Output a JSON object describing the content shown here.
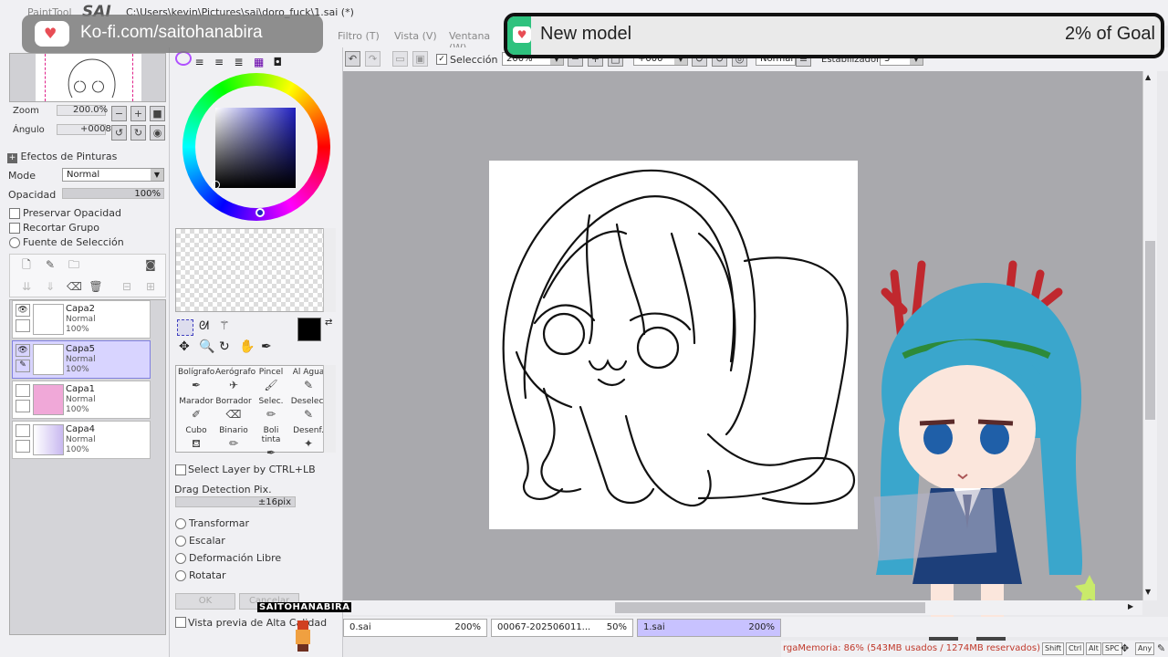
{
  "titlebar": {
    "app": "PaintTool",
    "logo": "SAI",
    "path": "C:\\Users\\kevin\\Pictures\\sai\\doro_fuck\\1.sai (*)"
  },
  "menu": {
    "filtro": "Filtro (T)",
    "vista": "Vista (V)",
    "ventana": "Ventana (W)"
  },
  "kofi": {
    "text": "Ko-fi.com/saitohanabira"
  },
  "goal": {
    "name": "New model",
    "progress": "2% of Goal",
    "accent": "#2ec27e"
  },
  "navigator": {
    "zoom_label": "Zoom",
    "zoom_value": "200.0%",
    "angle_label": "Ángulo",
    "angle_value": "+0008"
  },
  "effects": {
    "title": "Efectos de Pinturas",
    "mode_label": "Mode",
    "mode_value": "Normal",
    "opacity_label": "Opacidad",
    "opacity_value": "100%",
    "preserve": "Preservar Opacidad",
    "clip": "Recortar Grupo",
    "selection_source": "Fuente de Selección"
  },
  "layers": [
    {
      "name": "Capa2",
      "mode": "Normal",
      "opacity": "100%",
      "visible": true,
      "selected": false
    },
    {
      "name": "Capa5",
      "mode": "Normal",
      "opacity": "100%",
      "visible": true,
      "selected": true
    },
    {
      "name": "Capa1",
      "mode": "Normal",
      "opacity": "100%",
      "visible": false,
      "selected": false
    },
    {
      "name": "Capa4",
      "mode": "Normal",
      "opacity": "100%",
      "visible": false,
      "selected": false
    }
  ],
  "tools": [
    {
      "label": "Bolígrafo",
      "icon": "pen-icon"
    },
    {
      "label": "Aerógrafo",
      "icon": "airbrush-icon"
    },
    {
      "label": "Pincel",
      "icon": "brush-icon"
    },
    {
      "label": "Al Agua",
      "icon": "watercolor-icon"
    },
    {
      "label": "Marador",
      "icon": "marker-icon"
    },
    {
      "label": "Borrador",
      "icon": "eraser-icon"
    },
    {
      "label": "Selec.",
      "icon": "select-pen-icon"
    },
    {
      "label": "Deselec.",
      "icon": "deselect-icon"
    },
    {
      "label": "Cubo",
      "icon": "bucket-icon"
    },
    {
      "label": "Binario",
      "icon": "binary-pen-icon"
    },
    {
      "label": "Boli tinta",
      "icon": "ink-pen-icon"
    },
    {
      "label": "Desenf.",
      "icon": "blur-icon"
    }
  ],
  "transform": {
    "select_layer": "Select Layer by CTRL+LB",
    "drag_label": "Drag Detection Pix.",
    "drag_value": "±16pix",
    "opts": [
      "Transformar",
      "Escalar",
      "Deformación Libre",
      "Rotatar"
    ],
    "ok": "OK",
    "cancel": "Cancelar",
    "preview": "Vista previa de Alta Calidad"
  },
  "canvas_toolbar": {
    "selection": "Selección",
    "zoom": "200%",
    "angle": "+000°",
    "blend": "Normal",
    "stabilizer_label": "Estabilizador",
    "stabilizer_value": "3"
  },
  "watermark": "SAITOHANABIRA",
  "file_tabs": [
    {
      "name": "0.sai",
      "zoom": "200%",
      "selected": false
    },
    {
      "name": "00067-202506011...",
      "zoom": "50%",
      "selected": false
    },
    {
      "name": "1.sai",
      "zoom": "200%",
      "selected": true
    }
  ],
  "status": {
    "memory": "rgaMemoria: 86% (543MB usados / 1274MB reservados)",
    "keys": [
      "Shift",
      "Ctrl",
      "Alt",
      "SPC",
      "Any"
    ]
  },
  "colors": {
    "primary": "#000000",
    "secondary": "#ffffff"
  }
}
